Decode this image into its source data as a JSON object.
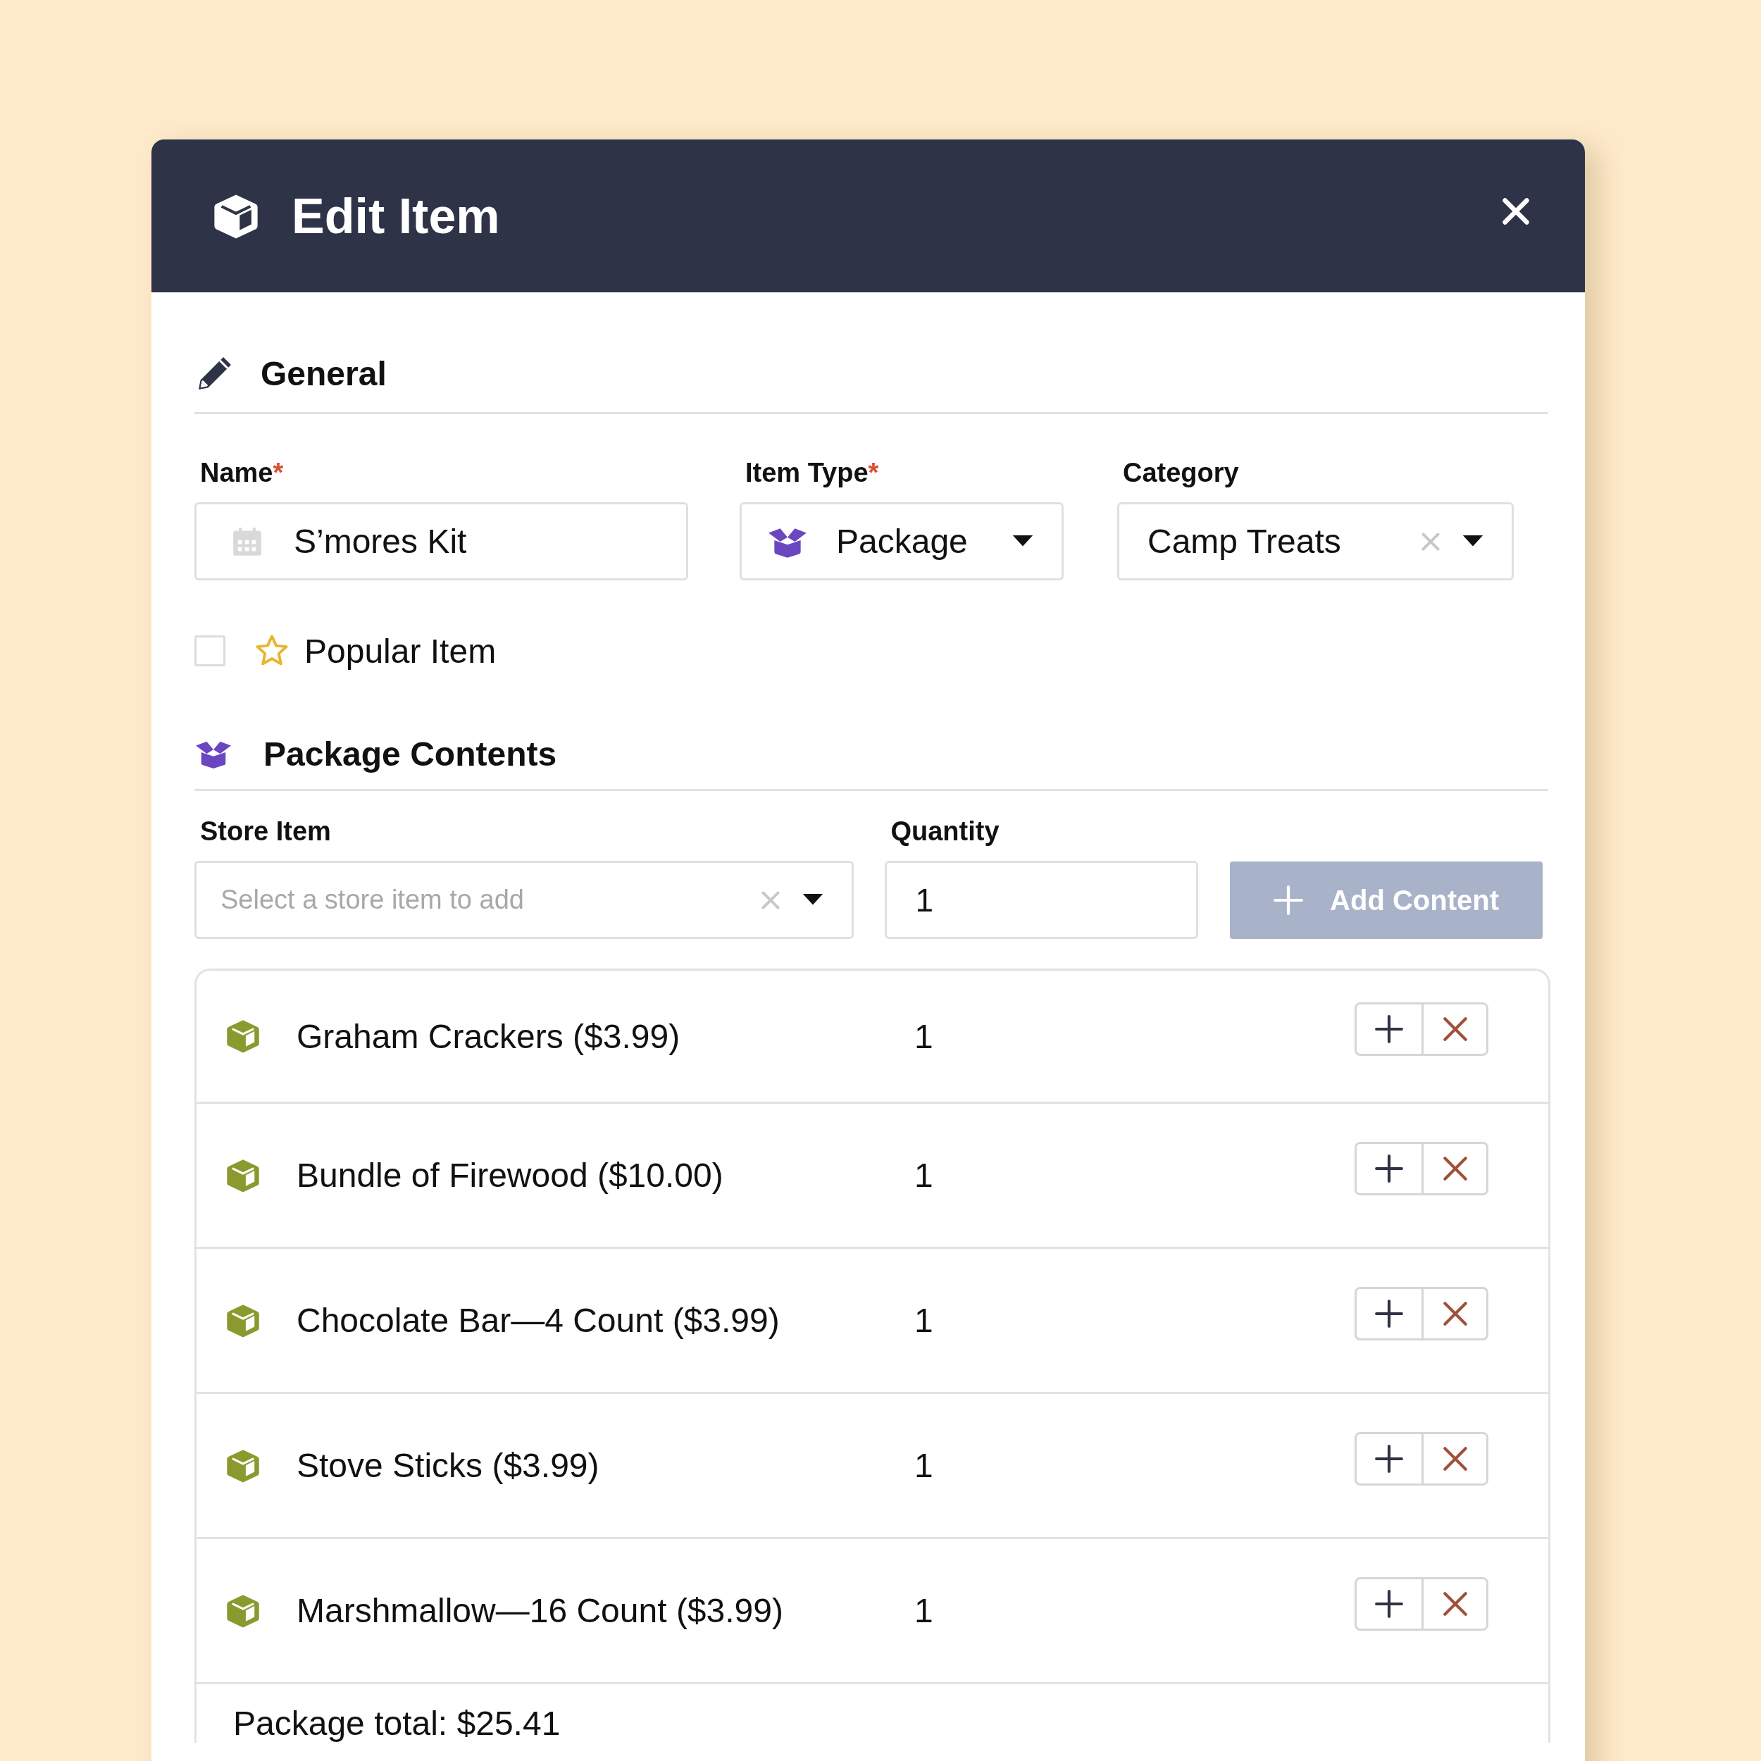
{
  "window": {
    "title": "Edit Item"
  },
  "general": {
    "heading": "General",
    "fields": [
      {
        "kind": "text",
        "label": "Name",
        "required_mark": "*",
        "value": "S’mores Kit"
      },
      {
        "kind": "type",
        "label": "Item Type",
        "required_mark": "*",
        "value": "Package"
      },
      {
        "kind": "select",
        "label": "Category",
        "value": "Camp Treats"
      }
    ],
    "popular_item": {
      "label": "Popular Item",
      "checked": false
    }
  },
  "package_contents": {
    "heading": "Package Contents",
    "store_item": {
      "label": "Store Item",
      "placeholder": "Select a store item to add"
    },
    "quantity": {
      "label": "Quantity",
      "value": "1"
    },
    "add_button": {
      "label": "Add Content",
      "disabled": true
    },
    "rows": [
      {
        "name": "Graham Crackers ($3.99)",
        "quantity": "1"
      },
      {
        "name": "Bundle of Firewood ($10.00)",
        "quantity": "1"
      },
      {
        "name": "Chocolate Bar—4 Count ($3.99)",
        "quantity": "1"
      },
      {
        "name": "Stove Sticks ($3.99)",
        "quantity": "1"
      },
      {
        "name": "Marshmallow—16 Count ($3.99)",
        "quantity": "1"
      }
    ],
    "total": "Package total: $25.41"
  }
}
